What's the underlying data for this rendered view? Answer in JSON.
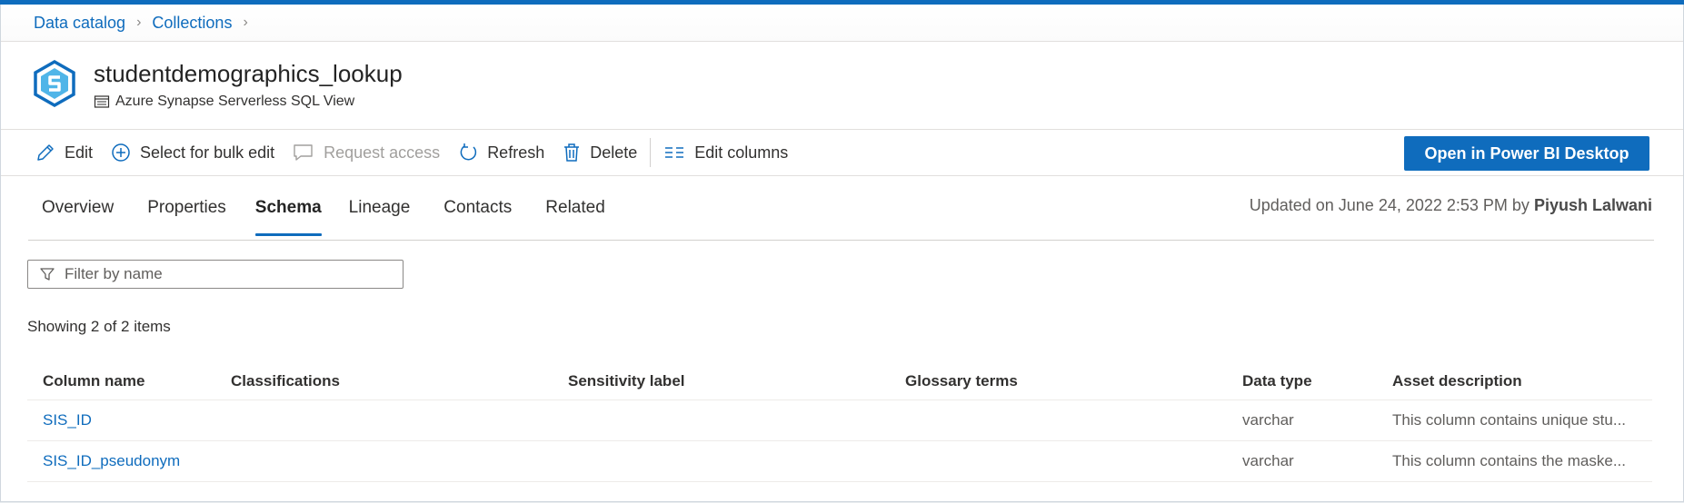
{
  "breadcrumb": {
    "items": [
      "Data catalog",
      "Collections"
    ]
  },
  "asset": {
    "title": "studentdemographics_lookup",
    "type": "Azure Synapse Serverless SQL View"
  },
  "toolbar": {
    "edit": "Edit",
    "bulk_edit": "Select for bulk edit",
    "request_access": "Request access",
    "refresh": "Refresh",
    "delete": "Delete",
    "edit_columns": "Edit columns",
    "open_pbi": "Open in Power BI Desktop"
  },
  "tabs": [
    "Overview",
    "Properties",
    "Schema",
    "Lineage",
    "Contacts",
    "Related"
  ],
  "active_tab": "Schema",
  "updated": {
    "prefix": "Updated on June 24, 2022 2:53 PM by",
    "user": "Piyush Lalwani"
  },
  "filter": {
    "placeholder": "Filter by name"
  },
  "count_text": "Showing 2 of 2 items",
  "table": {
    "headers": [
      "Column name",
      "Classifications",
      "Sensitivity label",
      "Glossary terms",
      "Data type",
      "Asset description"
    ],
    "rows": [
      {
        "name": "SIS_ID",
        "classifications": "",
        "sensitivity": "",
        "glossary": "",
        "type": "varchar",
        "description": "This column contains unique stu..."
      },
      {
        "name": "SIS_ID_pseudonym",
        "classifications": "",
        "sensitivity": "",
        "glossary": "",
        "type": "varchar",
        "description": "This column contains the maske..."
      }
    ]
  },
  "colors": {
    "accent": "#0f6cbd",
    "text": "#323130",
    "muted": "#605e5c"
  }
}
